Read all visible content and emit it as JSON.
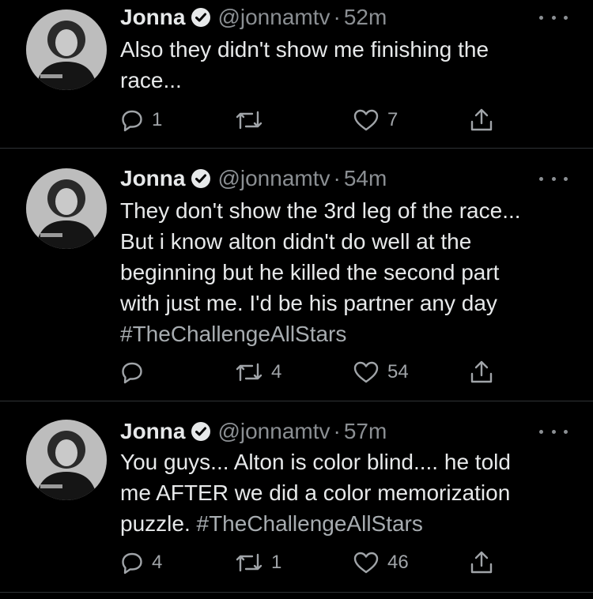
{
  "tweets": [
    {
      "name": "Jonna",
      "handle": "@jonnamtv",
      "separator": "·",
      "time": "52m",
      "text_lines": [
        "Also they didn't show me finishing the",
        "race..."
      ],
      "hashtag": "",
      "replies": "1",
      "retweets": "",
      "likes": "7"
    },
    {
      "name": "Jonna",
      "handle": "@jonnamtv",
      "separator": "·",
      "time": "54m",
      "text_lines": [
        "They don't show the 3rd leg of the race...",
        "But i know alton didn't do well at the",
        "beginning but he killed the second part",
        "with just me. I'd be his partner any day"
      ],
      "hashtag": "#TheChallengeAllStars",
      "replies": "",
      "retweets": "4",
      "likes": "54"
    },
    {
      "name": "Jonna",
      "handle": "@jonnamtv",
      "separator": "·",
      "time": "57m",
      "text_lines": [
        "You guys... Alton is color blind.... he told",
        "me AFTER we did a color memorization"
      ],
      "last_line_prefix": "puzzle. ",
      "hashtag": "#TheChallengeAllStars",
      "replies": "4",
      "retweets": "1",
      "likes": "46"
    }
  ],
  "icons": {
    "verified": "verified-badge-icon",
    "more": "more-horizontal-icon",
    "reply": "reply-bubble-icon",
    "retweet": "retweet-icon",
    "like": "heart-icon",
    "share": "share-upload-icon"
  },
  "colors": {
    "background": "#000000",
    "text": "#e7e9ea",
    "secondary": "#8b8f93",
    "hashtag": "#a7acb0",
    "divider": "#2f3336"
  }
}
